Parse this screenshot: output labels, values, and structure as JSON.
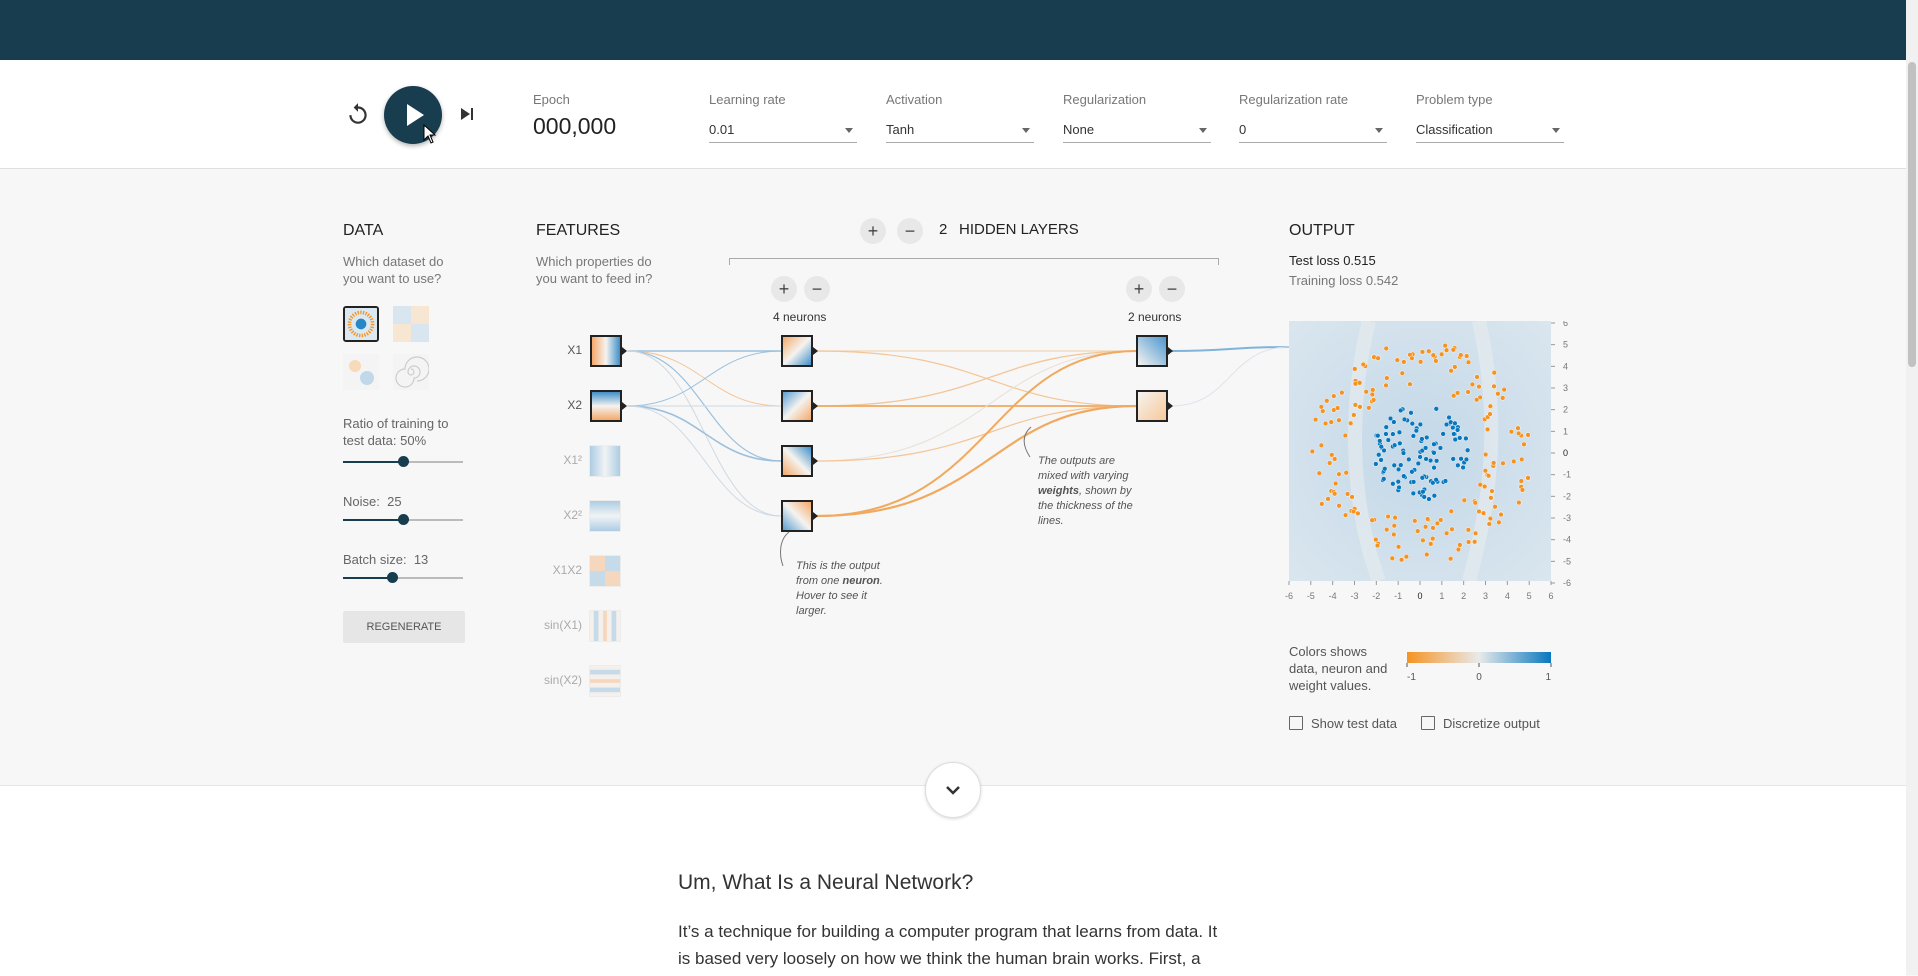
{
  "controls": {
    "epoch_label": "Epoch",
    "epoch_value": "000,000",
    "learning_rate": {
      "label": "Learning rate",
      "value": "0.01"
    },
    "activation": {
      "label": "Activation",
      "value": "Tanh"
    },
    "regularization": {
      "label": "Regularization",
      "value": "None"
    },
    "regularization_rate": {
      "label": "Regularization rate",
      "value": "0"
    },
    "problem_type": {
      "label": "Problem type",
      "value": "Classification"
    }
  },
  "data_panel": {
    "title": "DATA",
    "question": "Which dataset do you want to use?",
    "datasets": [
      "circle",
      "xor",
      "gauss",
      "spiral"
    ],
    "selected_dataset": "circle",
    "ratio_label": "Ratio of training to test data:",
    "ratio_value": "50%",
    "ratio_fraction": 0.5,
    "noise_label": "Noise:",
    "noise_value": "25",
    "noise_fraction": 0.5,
    "batch_label": "Batch size:",
    "batch_value": "13",
    "batch_fraction": 0.41,
    "regenerate_label": "REGENERATE"
  },
  "features_panel": {
    "title": "FEATURES",
    "question": "Which properties do you want to feed in?",
    "features": [
      {
        "name": "X1",
        "active": true
      },
      {
        "name": "X2",
        "active": true
      },
      {
        "name": "X1²",
        "active": false
      },
      {
        "name": "X2²",
        "active": false
      },
      {
        "name": "X1X2",
        "active": false
      },
      {
        "name": "sin(X1)",
        "active": false
      },
      {
        "name": "sin(X2)",
        "active": false
      }
    ]
  },
  "network": {
    "hidden_layers_count": "2",
    "hidden_layers_label": "HIDDEN LAYERS",
    "layer1_neurons": "4 neurons",
    "layer2_neurons": "2 neurons",
    "note_neuron_pre": "This is the output from one",
    "note_neuron_bold": "neuron",
    "note_neuron_post": ". Hover to see it larger.",
    "note_weights_pre": "The outputs are mixed with varying",
    "note_weights_bold": "weights",
    "note_weights_post": ", shown by the thickness of the lines."
  },
  "output_panel": {
    "title": "OUTPUT",
    "test_loss_label": "Test loss",
    "test_loss_value": "0.515",
    "training_loss_label": "Training loss",
    "training_loss_value": "0.542",
    "colors_desc": "Colors shows data, neuron and weight values.",
    "scale_min": "-1",
    "scale_mid": "0",
    "scale_max": "1",
    "show_test_data": "Show test data",
    "discretize_output": "Discretize output",
    "axis_ticks": [
      "-6",
      "-5",
      "-4",
      "-3",
      "-2",
      "-1",
      "0",
      "1",
      "2",
      "3",
      "4",
      "5",
      "6"
    ],
    "color_negative": "#f59322",
    "color_positive": "#0877bd"
  },
  "article": {
    "title": "Um, What Is a Neural Network?",
    "text": "It’s a technique for building a computer program that learns from data. It is based very loosely on how we think the human brain works. First, a"
  }
}
